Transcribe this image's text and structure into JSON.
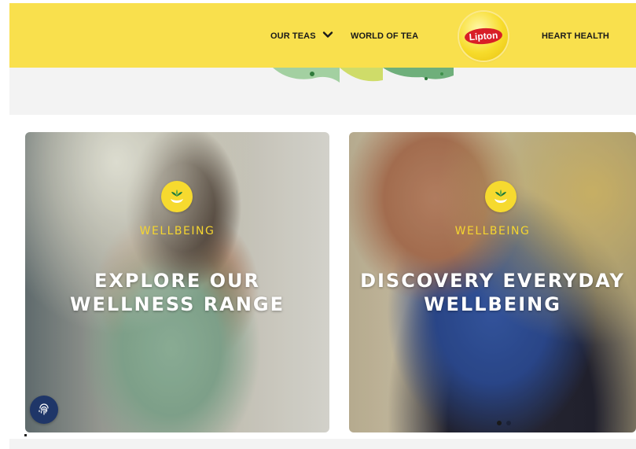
{
  "header": {
    "nav": [
      {
        "label": "OUR TEAS"
      },
      {
        "label": "WORLD OF TEA"
      },
      {
        "label": "HEART HEALTH"
      }
    ],
    "logo_text": "Lipton",
    "colors": {
      "header_bg": "#f9e04d",
      "logo_red": "#d81e27"
    }
  },
  "cards": [
    {
      "category": "WELLBEING",
      "title_line1": "EXPLORE OUR",
      "title_line2": "WELLNESS RANGE",
      "icon": "leaf-hand-icon"
    },
    {
      "category": "WELLBEING",
      "title_line1": "DISCOVERY EVERYDAY",
      "title_line2": "WELLBEING",
      "icon": "leaf-hand-icon"
    }
  ],
  "carousel": {
    "active_index": 1,
    "count": 2
  },
  "floating": {
    "icon": "fingerprint-icon",
    "color": "#1f3668"
  }
}
